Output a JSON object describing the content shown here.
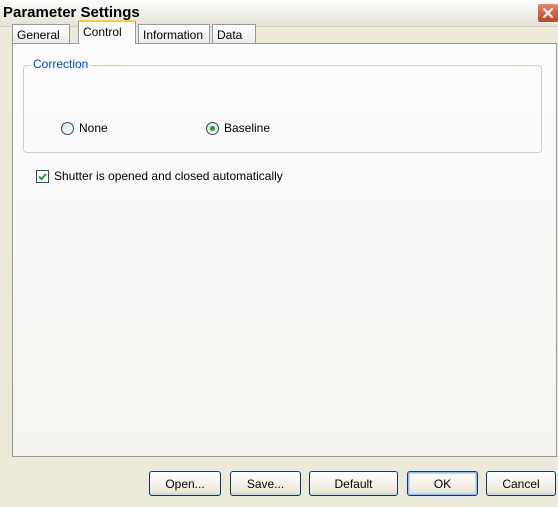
{
  "window": {
    "title": "Parameter Settings"
  },
  "tabs": [
    {
      "label": "General",
      "active": false
    },
    {
      "label": "Control",
      "active": true
    },
    {
      "label": "Information",
      "active": false
    },
    {
      "label": "Data",
      "active": false
    }
  ],
  "correction": {
    "title": "Correction",
    "options": [
      {
        "label": "None",
        "selected": false
      },
      {
        "label": "Baseline",
        "selected": true
      }
    ]
  },
  "shutter": {
    "label": "Shutter is opened and closed automatically",
    "checked": true
  },
  "buttons": {
    "open": "Open...",
    "save": "Save...",
    "default": "Default",
    "ok": "OK",
    "cancel": "Cancel"
  },
  "colors": {
    "group_title": "#0046d5",
    "radio_dot": "#21a121",
    "close_button": "#c4411d"
  }
}
